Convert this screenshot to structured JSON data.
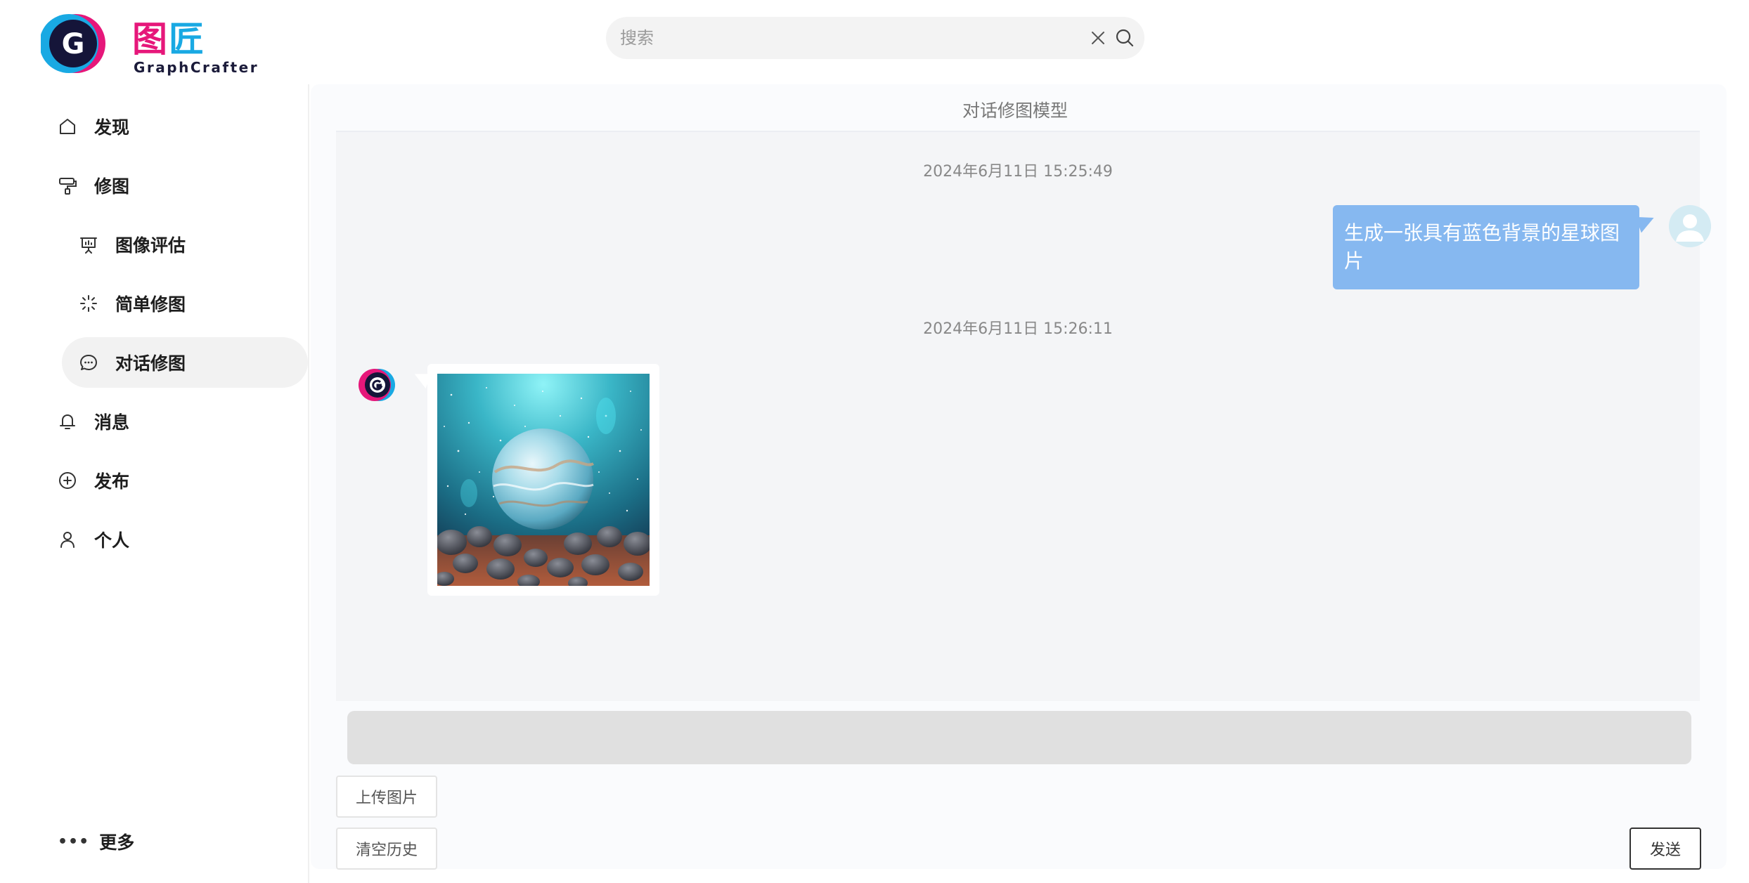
{
  "logo": {
    "mark_letter": "G",
    "cn_char_1": "图",
    "cn_char_2": "匠",
    "en_text": "GraphCrafter"
  },
  "search": {
    "placeholder": "搜索",
    "value": ""
  },
  "sidebar": {
    "items": [
      {
        "label": "发现",
        "icon": "home-icon"
      },
      {
        "label": "修图",
        "icon": "paint-roller-icon"
      },
      {
        "label": "图像评估",
        "icon": "presentation-board-icon"
      },
      {
        "label": "简单修图",
        "icon": "sparkle-loader-icon"
      },
      {
        "label": "对话修图",
        "icon": "chat-bubble-icon",
        "active": true
      },
      {
        "label": "消息",
        "icon": "bell-icon"
      },
      {
        "label": "发布",
        "icon": "plus-circle-icon"
      },
      {
        "label": "个人",
        "icon": "user-icon"
      }
    ],
    "more_dots": "•••",
    "more_label": "更多"
  },
  "main": {
    "title": "对话修图模型",
    "messages": [
      {
        "timestamp": "2024年6月11日 15:25:49",
        "from": "user",
        "text": "生成一张具有蓝色背景的星球图片"
      },
      {
        "timestamp": "2024年6月11日 15:26:11",
        "from": "bot",
        "image": "planet-image"
      }
    ],
    "input_value": "",
    "upload_label": "上传图片",
    "clear_label": "清空历史",
    "send_label": "发送"
  },
  "colors": {
    "brand_pink": "#e6177a",
    "brand_blue": "#19a9e3",
    "user_bubble": "#86b8f0",
    "active_nav_bg": "#f2f2f2"
  }
}
